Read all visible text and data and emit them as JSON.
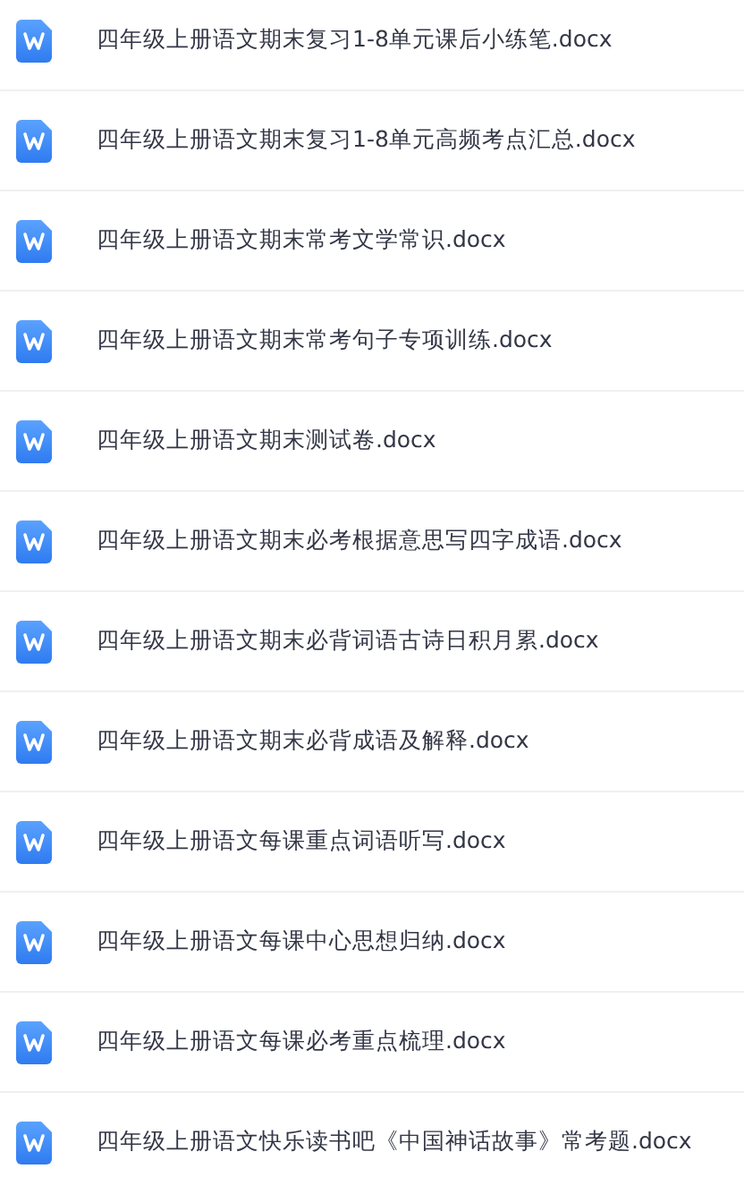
{
  "files": [
    {
      "name": "四年级上册语文期末复习1-8单元课后小练笔.docx",
      "kind": "docx"
    },
    {
      "name": "四年级上册语文期末复习1-8单元高频考点汇总.docx",
      "kind": "docx"
    },
    {
      "name": "四年级上册语文期末常考文学常识.docx",
      "kind": "docx"
    },
    {
      "name": "四年级上册语文期末常考句子专项训练.docx",
      "kind": "docx"
    },
    {
      "name": "四年级上册语文期末测试卷.docx",
      "kind": "docx"
    },
    {
      "name": "四年级上册语文期末必考根据意思写四字成语.docx",
      "kind": "docx"
    },
    {
      "name": "四年级上册语文期末必背词语古诗日积月累.docx",
      "kind": "docx"
    },
    {
      "name": "四年级上册语文期末必背成语及解释.docx",
      "kind": "docx"
    },
    {
      "name": "四年级上册语文每课重点词语听写.docx",
      "kind": "docx"
    },
    {
      "name": "四年级上册语文每课中心思想归纳.docx",
      "kind": "docx"
    },
    {
      "name": "四年级上册语文每课必考重点梳理.docx",
      "kind": "docx"
    },
    {
      "name": "四年级上册语文快乐读书吧《中国神话故事》常考题.docx",
      "kind": "docx"
    }
  ]
}
